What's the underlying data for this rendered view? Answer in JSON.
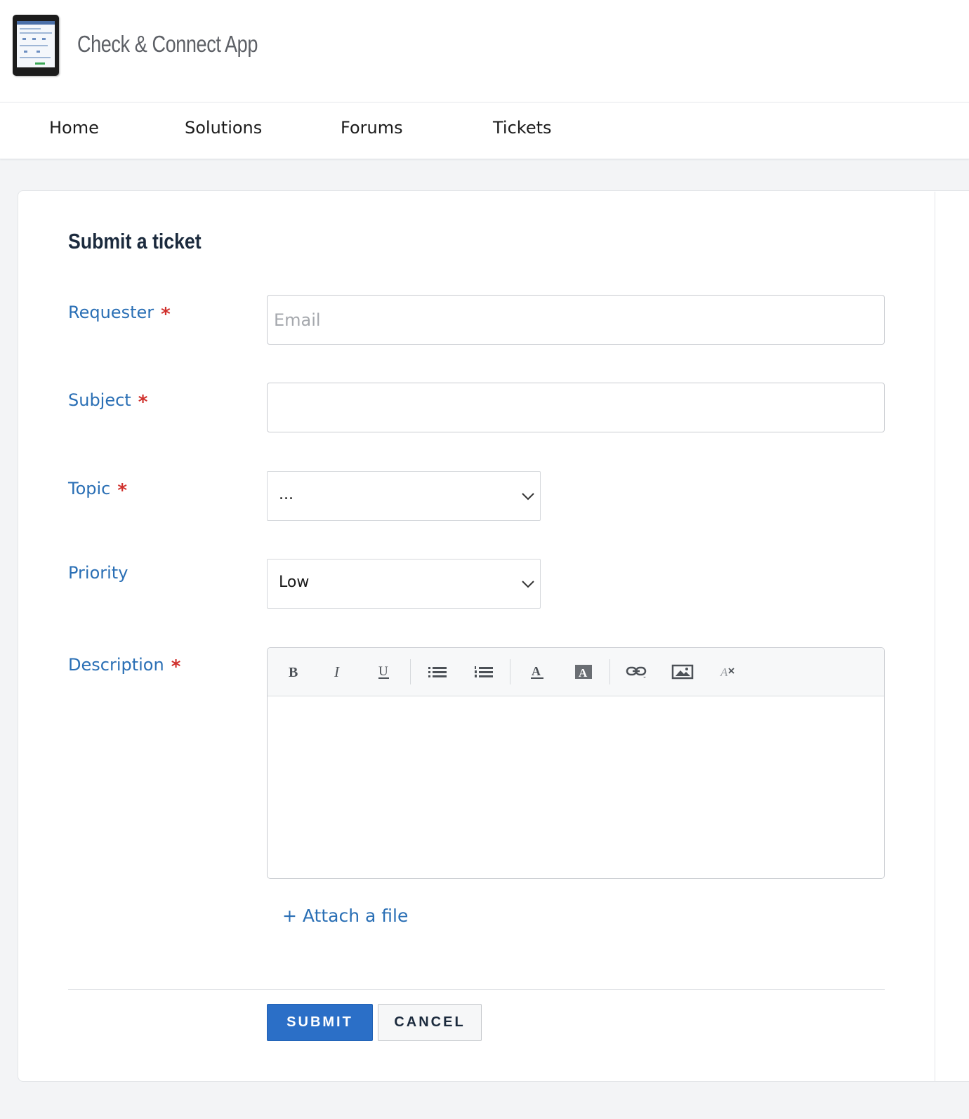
{
  "header": {
    "app_title": "Check & Connect App",
    "logo_icon": "tablet-app-logo"
  },
  "nav": {
    "items": [
      {
        "label": "Home"
      },
      {
        "label": "Solutions"
      },
      {
        "label": "Forums"
      },
      {
        "label": "Tickets"
      }
    ]
  },
  "form": {
    "title": "Submit a ticket",
    "required_marker": "*",
    "requester": {
      "label": "Requester",
      "placeholder": "Email",
      "value": ""
    },
    "subject": {
      "label": "Subject",
      "value": ""
    },
    "topic": {
      "label": "Topic",
      "selected": "..."
    },
    "priority": {
      "label": "Priority",
      "selected": "Low"
    },
    "description": {
      "label": "Description",
      "toolbar": [
        "bold-icon",
        "italic-icon",
        "underline-icon",
        "bullet-list-icon",
        "numbered-list-icon",
        "text-color-icon",
        "background-color-icon",
        "link-icon",
        "image-icon",
        "clear-formatting-icon"
      ]
    },
    "attach_label": "+ Attach a file",
    "submit_label": "SUBMIT",
    "cancel_label": "CANCEL"
  },
  "colors": {
    "accent": "#2b6fc7",
    "label": "#2a6fb5",
    "required": "#d0312d",
    "heading": "#1b2a3d",
    "page_bg": "#f3f4f6"
  }
}
